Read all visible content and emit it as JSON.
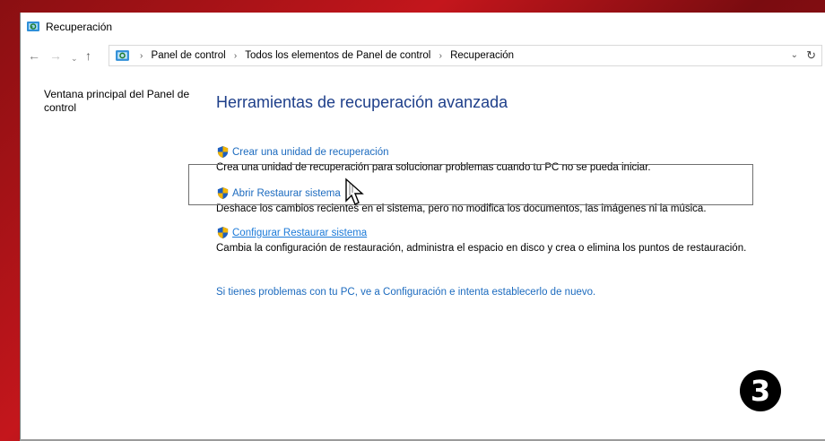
{
  "window": {
    "title": "Recuperación"
  },
  "addressbar": {
    "back_icon": "←",
    "forward_icon": "→",
    "dropdown_icon": "⌄",
    "up_icon": "↑",
    "crumbs": [
      "Panel de control",
      "Todos los elementos de Panel de control",
      "Recuperación"
    ],
    "separator": "›",
    "recent_dropdown_icon": "⌄",
    "refresh_icon": "↻"
  },
  "sidebar": {
    "home_link": "Ventana principal del Panel de control"
  },
  "main": {
    "heading": "Herramientas de recuperación avanzada",
    "tasks": [
      {
        "link": "Crear una unidad de recuperación",
        "description": "Crea una unidad de recuperación para solucionar problemas cuando tu PC no se pueda iniciar."
      },
      {
        "link": "Abrir Restaurar sistema",
        "description": "Deshace los cambios recientes en el sistema, pero no modifica los documentos, las imágenes ni la música."
      },
      {
        "link": "Configurar Restaurar sistema",
        "description": "Cambia la configuración de restauración, administra el espacio en disco y crea o elimina los puntos de restauración."
      }
    ],
    "help_link": "Si tienes problemas con tu PC, ve a Configuración e intenta establecerlo de nuevo."
  },
  "step_badge": "3",
  "colors": {
    "heading": "#1e3f8a",
    "link": "#1c6bbf",
    "desktop": "#c4161c"
  }
}
